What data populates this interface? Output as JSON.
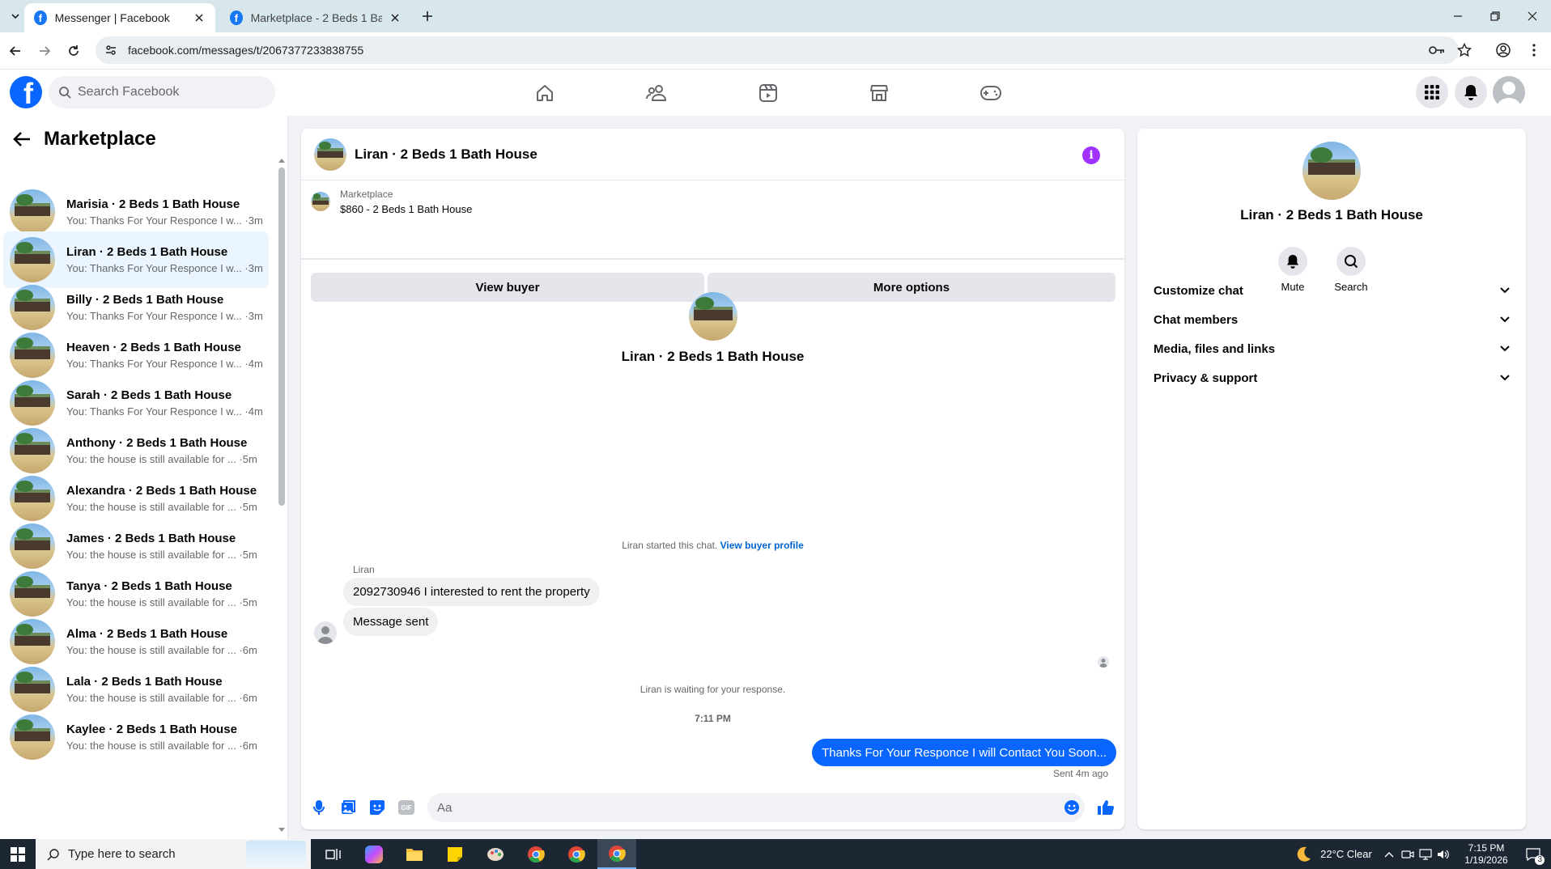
{
  "browser": {
    "tabs": [
      {
        "title": "Messenger | Facebook",
        "active": true
      },
      {
        "title": "Marketplace - 2 Beds 1 Bath Ho",
        "active": false
      }
    ],
    "url": "facebook.com/messages/t/2067377233838755"
  },
  "fbnav": {
    "search_placeholder": "Search Facebook"
  },
  "sidebar": {
    "title": "Marketplace",
    "conversations": [
      {
        "name": "Marisia · 2 Beds 1 Bath House",
        "preview": "You: Thanks For Your Responce I w... ·3m",
        "selected": false
      },
      {
        "name": "Liran · 2 Beds 1 Bath House",
        "preview": "You: Thanks For Your Responce I w... ·3m",
        "selected": true
      },
      {
        "name": "Billy · 2 Beds 1 Bath House",
        "preview": "You: Thanks For Your Responce I w... ·3m",
        "selected": false
      },
      {
        "name": "Heaven · 2 Beds 1 Bath House",
        "preview": "You: Thanks For Your Responce I w... ·4m",
        "selected": false
      },
      {
        "name": "Sarah · 2 Beds 1 Bath House",
        "preview": "You: Thanks For Your Responce I w... ·4m",
        "selected": false
      },
      {
        "name": "Anthony · 2 Beds 1 Bath House",
        "preview": "You: the house is still available for ... ·5m",
        "selected": false
      },
      {
        "name": "Alexandra · 2 Beds 1 Bath House",
        "preview": "You: the house is still available for ... ·5m",
        "selected": false
      },
      {
        "name": "James · 2 Beds 1 Bath House",
        "preview": "You: the house is still available for ... ·5m",
        "selected": false
      },
      {
        "name": "Tanya · 2 Beds 1 Bath House",
        "preview": "You: the house is still available for ... ·5m",
        "selected": false
      },
      {
        "name": "Alma · 2 Beds 1 Bath House",
        "preview": "You: the house is still available for ... ·6m",
        "selected": false
      },
      {
        "name": "Lala · 2 Beds 1 Bath House",
        "preview": "You: the house is still available for ... ·6m",
        "selected": false
      },
      {
        "name": "Kaylee · 2 Beds 1 Bath House",
        "preview": "You: the house is still available for ... ·6m",
        "selected": false
      }
    ]
  },
  "chat": {
    "title": "Liran · 2 Beds 1 Bath House",
    "marketplace_label": "Marketplace",
    "listing": "$860 - 2 Beds 1 Bath House",
    "view_buyer": "View buyer",
    "more_options": "More options",
    "intro_name": "Liran · 2 Beds 1 Bath House",
    "started_text": "Liran started this chat.",
    "view_buyer_profile": "View buyer profile",
    "sender_name": "Liran",
    "messages_in": [
      "2092730946 I interested to rent the property",
      "Message sent"
    ],
    "waiting_text": "Liran is waiting for your response.",
    "timestamp": "7:11 PM",
    "message_out": "Thanks For Your Responce I will Contact You Soon...",
    "sent_status": "Sent 4m ago",
    "input_placeholder": "Aa",
    "gif_label": "GIF"
  },
  "info_panel": {
    "name": "Liran · 2 Beds 1 Bath House",
    "mute": "Mute",
    "search": "Search",
    "sections": [
      "Customize chat",
      "Chat members",
      "Media, files and links",
      "Privacy & support"
    ]
  },
  "taskbar": {
    "search_placeholder": "Type here to search",
    "weather": "22°C  Clear",
    "time": "7:15 PM",
    "date": "1/19/2026",
    "notif_count": "3"
  },
  "colors": {
    "fb_blue": "#0866ff",
    "selected_bg": "#ebf5ff",
    "info_purple": "#a033ff",
    "link_blue": "#0064d1"
  }
}
